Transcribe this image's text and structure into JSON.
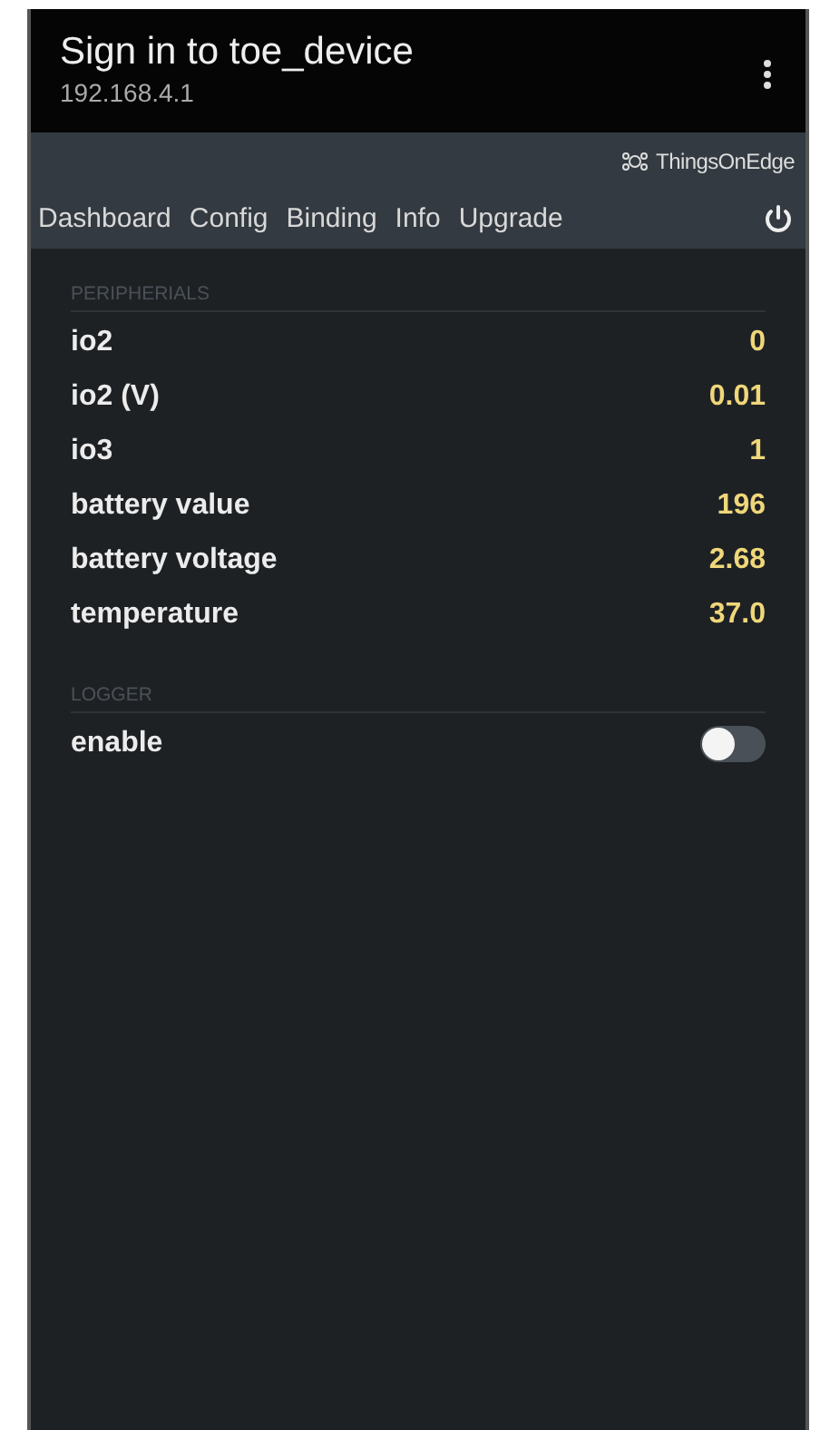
{
  "header": {
    "title": "Sign in to toe_device",
    "subtitle": "192.168.4.1"
  },
  "brand": {
    "name": "ThingsOnEdge"
  },
  "nav": [
    {
      "label": "Dashboard"
    },
    {
      "label": "Config"
    },
    {
      "label": "Binding"
    },
    {
      "label": "Info"
    },
    {
      "label": "Upgrade"
    }
  ],
  "sections": [
    {
      "title": "PERIPHERIALS",
      "rows": [
        {
          "kind": "value",
          "label": "io2",
          "value": "0"
        },
        {
          "kind": "value",
          "label": "io2 (V)",
          "value": "0.01"
        },
        {
          "kind": "value",
          "label": "io3",
          "value": "1"
        },
        {
          "kind": "value",
          "label": "battery value",
          "value": "196"
        },
        {
          "kind": "value",
          "label": "battery voltage",
          "value": "2.68"
        },
        {
          "kind": "value",
          "label": "temperature",
          "value": "37.0"
        }
      ]
    },
    {
      "title": "LOGGER",
      "rows": [
        {
          "kind": "switch",
          "label": "enable",
          "on": false
        }
      ]
    }
  ]
}
